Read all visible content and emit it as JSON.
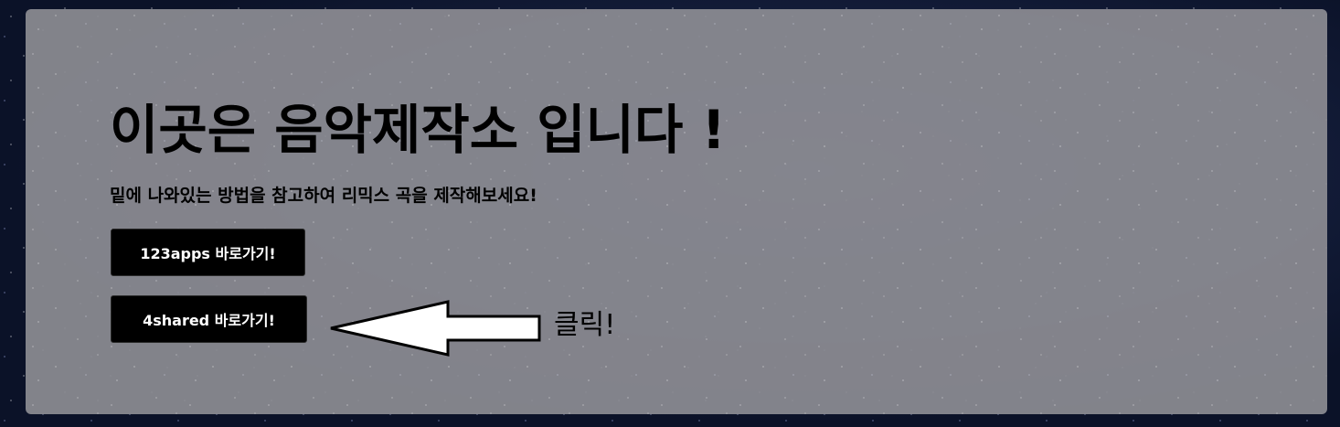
{
  "hero": {
    "title": "이곳은 음악제작소 입니다 !",
    "subtitle": "밑에 나와있는 방법을 참고하여 리믹스 곡을 제작해보세요!"
  },
  "buttons": [
    {
      "label": "123apps 바로가기!"
    },
    {
      "label": "4shared 바로가기!"
    }
  ],
  "annotation": {
    "icon": "arrow-left-icon",
    "text": "클릭!"
  },
  "colors": {
    "panel": "#8c8c92",
    "button_bg": "#000000",
    "button_text": "#ffffff",
    "text": "#000000"
  }
}
